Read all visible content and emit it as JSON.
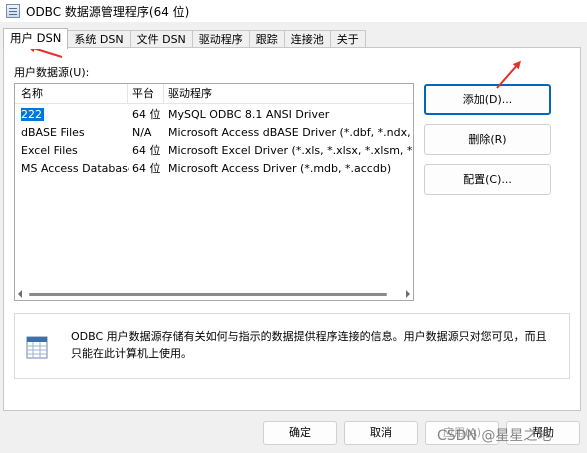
{
  "window": {
    "title": "ODBC 数据源管理程序(64 位)"
  },
  "tabs": [
    {
      "label": "用户 DSN"
    },
    {
      "label": "系统 DSN"
    },
    {
      "label": "文件 DSN"
    },
    {
      "label": "驱动程序"
    },
    {
      "label": "跟踪"
    },
    {
      "label": "连接池"
    },
    {
      "label": "关于"
    }
  ],
  "user_dsn": {
    "list_label": "用户数据源(U):",
    "columns": [
      "名称",
      "平台",
      "驱动程序"
    ],
    "rows": [
      {
        "name": "222",
        "platform": "64 位",
        "driver": "MySQL ODBC 8.1 ANSI Driver"
      },
      {
        "name": "dBASE Files",
        "platform": "N/A",
        "driver": "Microsoft Access dBASE Driver (*.dbf, *.ndx, *.mdx)"
      },
      {
        "name": "Excel Files",
        "platform": "64 位",
        "driver": "Microsoft Excel Driver (*.xls, *.xlsx, *.xlsm, *.xlsb)"
      },
      {
        "name": "MS Access Database",
        "platform": "64 位",
        "driver": "Microsoft Access Driver (*.mdb, *.accdb)"
      }
    ],
    "buttons": {
      "add": "添加(D)...",
      "remove": "删除(R)",
      "configure": "配置(C)..."
    },
    "info_text": "ODBC 用户数据源存储有关如何与指示的数据提供程序连接的信息。用户数据源只对您可见，而且只能在此计算机上使用。"
  },
  "footer": {
    "ok": "确定",
    "cancel": "取消",
    "apply": "应用(A)",
    "help": "帮助"
  },
  "watermark": "CSDN @星星之地",
  "colors": {
    "selection": "#0078d7",
    "annotation_arrow": "#e8302a",
    "default_button_border": "#0067c0"
  },
  "icons": {
    "app": "odbc-app-icon",
    "info": "data-table-icon"
  }
}
